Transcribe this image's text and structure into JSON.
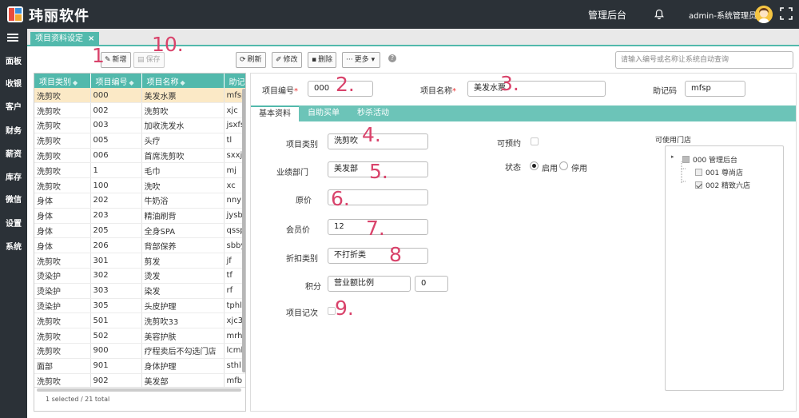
{
  "app": {
    "title": "玮丽软件",
    "admin_title": "管理后台",
    "user_name": "admin-系统管理员"
  },
  "sidebar": {
    "items": [
      {
        "label": "面板"
      },
      {
        "label": "收银"
      },
      {
        "label": "客户"
      },
      {
        "label": "财务"
      },
      {
        "label": "薪资"
      },
      {
        "label": "库存"
      },
      {
        "label": "微信"
      },
      {
        "label": "设置"
      },
      {
        "label": "系统"
      }
    ]
  },
  "tabs": [
    {
      "label": "项目资料设定",
      "close": "×"
    }
  ],
  "toolbar": {
    "add_label": "新增",
    "save_label": "保存",
    "refresh_label": "刷新",
    "edit_label": "修改",
    "delete_label": "删除",
    "more_label": "更多",
    "help": "?",
    "search_placeholder": "请输入编号或名称让系统自动查询"
  },
  "table": {
    "columns": [
      "项目类别",
      "项目编号",
      "项目名称",
      "助记码"
    ],
    "rows": [
      [
        "洗剪吹",
        "000",
        "美发水票",
        "mfsp"
      ],
      [
        "洗剪吹",
        "002",
        "洗剪吹",
        "xjc"
      ],
      [
        "洗剪吹",
        "003",
        "加收洗发水",
        "jsxfs"
      ],
      [
        "洗剪吹",
        "005",
        "头疗",
        "tl"
      ],
      [
        "洗剪吹",
        "006",
        "首席洗剪吹",
        "sxxjc"
      ],
      [
        "洗剪吹",
        "1",
        "毛巾",
        "mj"
      ],
      [
        "洗剪吹",
        "100",
        "洗吹",
        "xc"
      ],
      [
        "身体",
        "202",
        "牛奶浴",
        "nny"
      ],
      [
        "身体",
        "203",
        "精油刷背",
        "jysb"
      ],
      [
        "身体",
        "205",
        "全身SPA",
        "qssp"
      ],
      [
        "身体",
        "206",
        "背部保养",
        "sbby"
      ],
      [
        "洗剪吹",
        "301",
        "剪发",
        "jf"
      ],
      [
        "烫染护",
        "302",
        "烫发",
        "tf"
      ],
      [
        "烫染护",
        "303",
        "染发",
        "rf"
      ],
      [
        "烫染护",
        "305",
        "头皮护理",
        "tphl"
      ],
      [
        "洗剪吹",
        "501",
        "洗剪吹33",
        "xjc33"
      ],
      [
        "洗剪吹",
        "502",
        "美容护肤",
        "mrhf"
      ],
      [
        "洗剪吹",
        "900",
        "疗程卖后不勾选门店",
        "lcmh"
      ],
      [
        "面部",
        "901",
        "身体护理",
        "sthl"
      ],
      [
        "洗剪吹",
        "902",
        "美发部",
        "mfb"
      ]
    ],
    "selected_index": 0,
    "footer": "1 selected / 21 total"
  },
  "form": {
    "code_label": "项目编号",
    "code_value": "000",
    "name_label": "项目名称",
    "name_value": "美发水票",
    "mnemonic_label": "助记码",
    "mnemonic_value": "mfsp",
    "required_mark": "*",
    "subtabs": [
      "基本资料",
      "自助买单",
      "秒杀活动"
    ],
    "category_label": "项目类别",
    "category_value": "洗剪吹",
    "dept_label": "业绩部门",
    "dept_value": "美发部",
    "price_label": "原价",
    "price_value": "",
    "member_price_label": "会员价",
    "member_price_value": "12",
    "discount_label": "折扣类别",
    "discount_value": "不打折类",
    "points_label": "积分",
    "points_mode_value": "营业额比例",
    "points_value": "0",
    "count_label": "项目记次",
    "bookable_label": "可预约",
    "status_label": "状态",
    "status_enabled": "启用",
    "status_disabled": "停用",
    "stores_label": "可使用门店",
    "stores_tree": {
      "root": "000 管理后台",
      "children": [
        {
          "label": "001 尊尚店",
          "checked": false
        },
        {
          "label": "002 精致六店",
          "checked": true
        }
      ]
    }
  },
  "annotations": [
    "1",
    "2.",
    "3.",
    "4.",
    "5.",
    "6.",
    "7.",
    "8",
    "9.",
    "10."
  ]
}
